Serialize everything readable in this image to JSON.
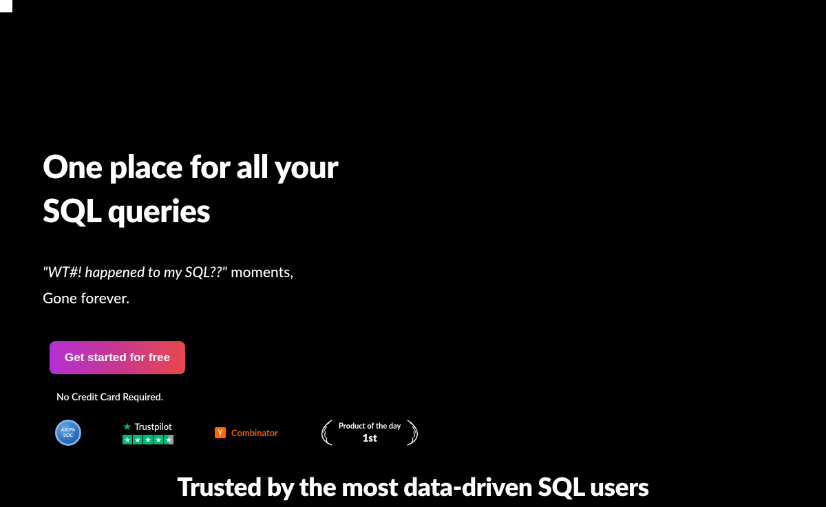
{
  "hero": {
    "headline_line1": "One place for all your",
    "headline_line2": "SQL queries",
    "sub_italic": "\"WT#! happened to my SQL??\"",
    "sub_rest": " moments,",
    "sub_line2": "Gone forever."
  },
  "cta": {
    "label": "Get started for free",
    "no_cc": "No Credit Card Required."
  },
  "badges": {
    "soc_line1": "AICPA",
    "soc_line2": "SOC",
    "trustpilot_label": "Trustpilot",
    "yc_letter": "Y",
    "yc_label": "Combinator",
    "potd_label": "Product of the day",
    "potd_rank": "1st"
  },
  "trusted_heading": "Trusted by the most data-driven SQL users"
}
